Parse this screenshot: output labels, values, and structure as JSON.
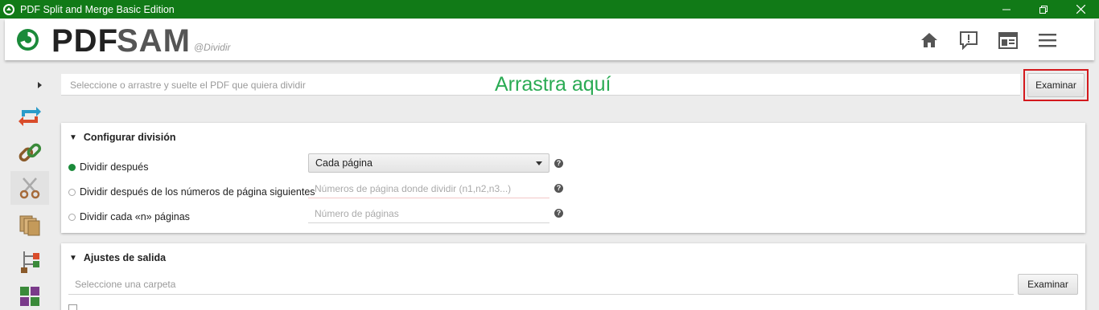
{
  "window": {
    "title": "PDF Split and Merge Basic Edition",
    "minimize_glyph": "—",
    "maximize_glyph": "❐",
    "close_glyph": "✕"
  },
  "header": {
    "logo_pdf": "PDF",
    "logo_sam": "SAM",
    "module": "@Dividir",
    "icons": [
      "home-icon",
      "feedback-icon",
      "news-icon",
      "menu-icon"
    ]
  },
  "sidebar": {
    "toggle_glyph": "▸",
    "items": [
      {
        "name": "merge-module-icon"
      },
      {
        "name": "link-module-icon"
      },
      {
        "name": "split-module-icon",
        "active": true
      },
      {
        "name": "extract-module-icon"
      },
      {
        "name": "split-by-bookmarks-icon"
      },
      {
        "name": "alternate-mix-icon"
      }
    ]
  },
  "input": {
    "placeholder": "Seleccione o arrastre y suelte el PDF que quiera dividir",
    "drag_hint": "Arrastra aquí",
    "browse_label": "Examinar"
  },
  "split_settings": {
    "title": "Configurar división",
    "options": [
      {
        "label": "Dividir después",
        "selected": true
      },
      {
        "label": "Dividir después de los números de página siguientes",
        "selected": false
      },
      {
        "label": "Dividir cada «n» páginas",
        "selected": false
      }
    ],
    "after_select_value": "Cada página",
    "page_numbers_placeholder": "Números de página donde dividir (n1,n2,n3...)",
    "every_n_placeholder": "Número de páginas",
    "help_glyph": "?"
  },
  "output": {
    "title": "Ajustes de salida",
    "folder_placeholder": "Seleccione una carpeta",
    "browse_label": "Examinar"
  },
  "colors": {
    "titlebar": "#117a17",
    "accent": "#1b8a3a",
    "drag_hint": "#2bab54",
    "highlight": "#d3191d"
  }
}
